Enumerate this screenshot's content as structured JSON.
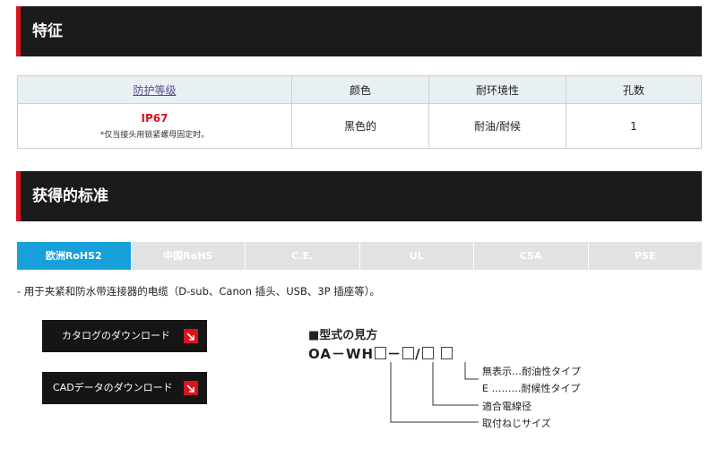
{
  "features": {
    "heading": "特征",
    "table": {
      "headers": [
        "防护等级",
        "颜色",
        "耐环境性",
        "孔数"
      ],
      "row": {
        "protection_value": "IP67",
        "protection_note": "*仅当接头用锁紧螺母固定时。",
        "color": "黑色的",
        "resistance": "耐油/耐候",
        "holes": "1"
      }
    }
  },
  "standards": {
    "heading": "获得的标准",
    "tabs": [
      "欧洲RoHS2",
      "中国RoHS",
      "C.E.",
      "UL",
      "CSA",
      "PSE"
    ],
    "active_tab": "欧洲RoHS2"
  },
  "usage": "-   用于夹紧和防水带连接器的电缆（D-sub、Canon 插头、USB、3P 插座等）。",
  "downloads": {
    "catalog_label": "カタログのダウンロード",
    "cad_label": "CADデータのダウンロード"
  },
  "model": {
    "title": "■型式の見方",
    "code_prefix": "OA－WH",
    "code_dash": "－",
    "code_slash": "/",
    "legend": [
      "無表示…耐油性タイプ",
      "E ………耐候性タイプ",
      "適合電線径",
      "取付ねじサイズ"
    ]
  },
  "colors": {
    "accent_red": "#d9141e",
    "tab_active": "#18a0db",
    "header_bg": "#1b1b1b"
  }
}
